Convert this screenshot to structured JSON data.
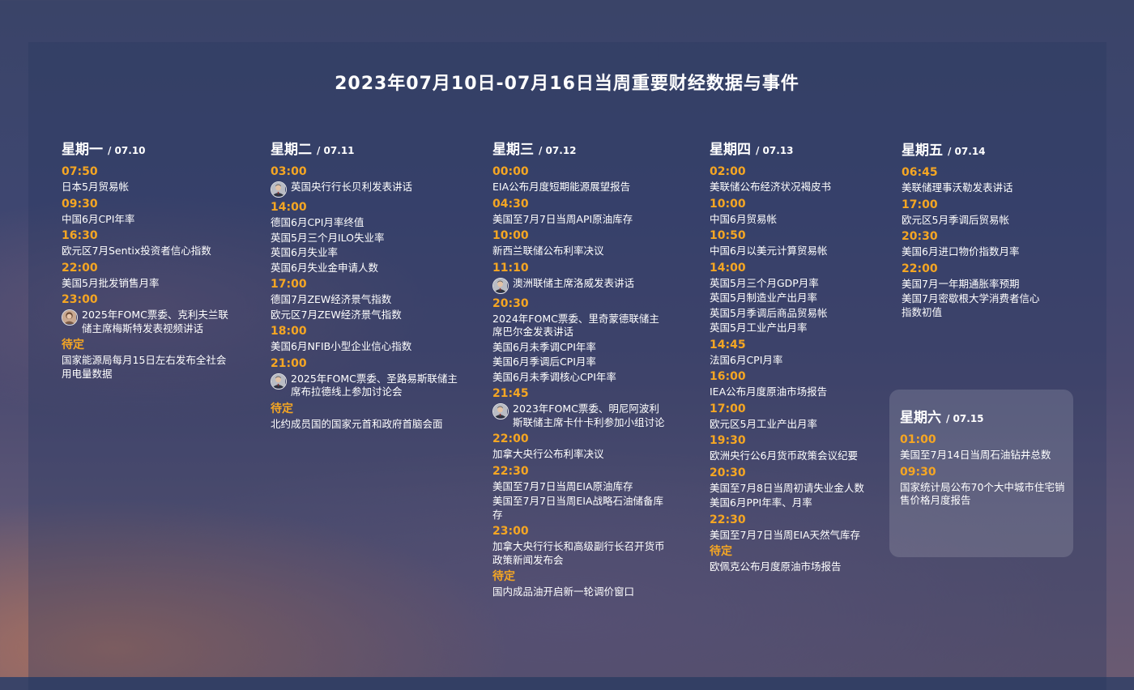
{
  "title": "2023年07月10日-07月16日当周重要财经数据与事件",
  "days": [
    {
      "name": "星期一",
      "date": "/ 07.10",
      "events": [
        {
          "time": "07:50",
          "items": [
            {
              "text": "日本5月贸易帐"
            }
          ]
        },
        {
          "time": "09:30",
          "items": [
            {
              "text": "中国6月CPI年率"
            }
          ]
        },
        {
          "time": "16:30",
          "items": [
            {
              "text": "欧元区7月Sentix投资者信心指数"
            }
          ]
        },
        {
          "time": "22:00",
          "items": [
            {
              "text": "美国5月批发销售月率"
            }
          ]
        },
        {
          "time": "23:00",
          "items": [
            {
              "text": "2025年FOMC票委、克利夫兰联储主席梅斯特发表视频讲话",
              "avatar": "speaker-avatar-woman"
            }
          ]
        },
        {
          "time": "待定",
          "items": [
            {
              "text": "国家能源局每月15日左右发布全社会用电量数据"
            }
          ]
        }
      ]
    },
    {
      "name": "星期二",
      "date": "/ 07.11",
      "events": [
        {
          "time": "03:00",
          "items": [
            {
              "text": "英国央行行长贝利发表讲话",
              "avatar": "speaker-avatar-man"
            }
          ]
        },
        {
          "time": "14:00",
          "items": [
            {
              "text": "德国6月CPI月率终值"
            },
            {
              "text": "英国5月三个月ILO失业率"
            },
            {
              "text": "英国6月失业率"
            },
            {
              "text": "英国6月失业金申请人数"
            }
          ]
        },
        {
          "time": "17:00",
          "items": [
            {
              "text": "德国7月ZEW经济景气指数"
            },
            {
              "text": "欧元区7月ZEW经济景气指数"
            }
          ]
        },
        {
          "time": "18:00",
          "items": [
            {
              "text": "美国6月NFIB小型企业信心指数"
            }
          ]
        },
        {
          "time": "21:00",
          "items": [
            {
              "text": "2025年FOMC票委、圣路易斯联储主席布拉德线上参加讨论会",
              "avatar": "speaker-avatar-man"
            }
          ]
        },
        {
          "time": "待定",
          "items": [
            {
              "text": "北约成员国的国家元首和政府首脑会面"
            }
          ]
        }
      ]
    },
    {
      "name": "星期三",
      "date": "/ 07.12",
      "events": [
        {
          "time": "00:00",
          "items": [
            {
              "text": "EIA公布月度短期能源展望报告"
            }
          ]
        },
        {
          "time": "04:30",
          "items": [
            {
              "text": "美国至7月7日当周API原油库存"
            }
          ]
        },
        {
          "time": "10:00",
          "items": [
            {
              "text": "新西兰联储公布利率决议"
            }
          ]
        },
        {
          "time": "11:10",
          "items": [
            {
              "text": "澳洲联储主席洛威发表讲话",
              "avatar": "speaker-avatar-man"
            }
          ]
        },
        {
          "time": "20:30",
          "items": [
            {
              "text": "2024年FOMC票委、里奇蒙德联储主席巴尔金发表讲话"
            },
            {
              "text": "美国6月未季调CPI年率"
            },
            {
              "text": "美国6月季调后CPI月率"
            },
            {
              "text": "美国6月未季调核心CPI年率"
            }
          ]
        },
        {
          "time": "21:45",
          "items": [
            {
              "text": "2023年FOMC票委、明尼阿波利斯联储主席卡什卡利参加小组讨论",
              "avatar": "speaker-avatar-man"
            }
          ]
        },
        {
          "time": "22:00",
          "items": [
            {
              "text": "加拿大央行公布利率决议"
            }
          ]
        },
        {
          "time": "22:30",
          "items": [
            {
              "text": "美国至7月7日当周EIA原油库存"
            },
            {
              "text": "美国至7月7日当周EIA战略石油储备库存"
            }
          ]
        },
        {
          "time": "23:00",
          "items": [
            {
              "text": "加拿大央行行长和高级副行长召开货币政策新闻发布会"
            }
          ]
        },
        {
          "time": "待定",
          "items": [
            {
              "text": "国内成品油开启新一轮调价窗口"
            }
          ]
        }
      ]
    },
    {
      "name": "星期四",
      "date": "/ 07.13",
      "events": [
        {
          "time": "02:00",
          "items": [
            {
              "text": "美联储公布经济状况褐皮书"
            }
          ]
        },
        {
          "time": "10:00",
          "items": [
            {
              "text": "中国6月贸易帐"
            }
          ]
        },
        {
          "time": "10:50",
          "items": [
            {
              "text": "中国6月以美元计算贸易帐"
            }
          ]
        },
        {
          "time": "14:00",
          "items": [
            {
              "text": "英国5月三个月GDP月率"
            },
            {
              "text": "英国5月制造业产出月率"
            },
            {
              "text": "英国5月季调后商品贸易帐"
            },
            {
              "text": "英国5月工业产出月率"
            }
          ]
        },
        {
          "time": "14:45",
          "items": [
            {
              "text": "法国6月CPI月率"
            }
          ]
        },
        {
          "time": "16:00",
          "items": [
            {
              "text": "IEA公布月度原油市场报告"
            }
          ]
        },
        {
          "time": "17:00",
          "items": [
            {
              "text": "欧元区5月工业产出月率"
            }
          ]
        },
        {
          "time": "19:30",
          "items": [
            {
              "text": "欧洲央行公6月货币政策会议纪要"
            }
          ]
        },
        {
          "time": "20:30",
          "items": [
            {
              "text": "美国至7月8日当周初请失业金人数"
            },
            {
              "text": "美国6月PPI年率、月率"
            }
          ]
        },
        {
          "time": "22:30",
          "items": [
            {
              "text": "美国至7月7日当周EIA天然气库存"
            }
          ]
        },
        {
          "time": "待定",
          "items": [
            {
              "text": "欧佩克公布月度原油市场报告"
            }
          ]
        }
      ]
    },
    {
      "name": "星期五",
      "date": "/ 07.14",
      "events": [
        {
          "time": "06:45",
          "items": [
            {
              "text": "美联储理事沃勒发表讲话"
            }
          ]
        },
        {
          "time": "17:00",
          "items": [
            {
              "text": "欧元区5月季调后贸易帐"
            }
          ]
        },
        {
          "time": "20:30",
          "items": [
            {
              "text": "美国6月进口物价指数月率"
            }
          ]
        },
        {
          "time": "22:00",
          "items": [
            {
              "text": "美国7月一年期通胀率预期"
            },
            {
              "text": "美国7月密歇根大学消费者信心指数初值"
            }
          ]
        }
      ]
    },
    {
      "name": "星期六",
      "date": "/ 07.15",
      "events": [
        {
          "time": "01:00",
          "items": [
            {
              "text": "美国至7月14日当周石油钻井总数"
            }
          ]
        },
        {
          "time": "09:30",
          "items": [
            {
              "text": "国家统计局公布70个大中城市住宅销售价格月度报告"
            }
          ]
        }
      ]
    }
  ]
}
